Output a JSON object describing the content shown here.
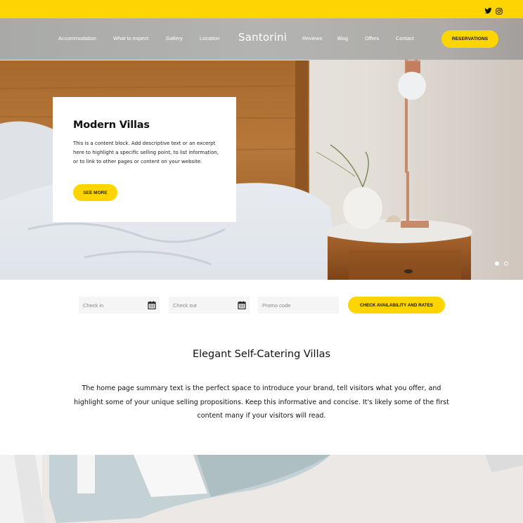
{
  "colors": {
    "accent": "#ffd500",
    "text": "#111111",
    "input_bg": "#f5f5f5"
  },
  "topbar": {
    "social_icons": [
      "twitter-icon",
      "instagram-icon"
    ]
  },
  "header": {
    "brand": "Santorini",
    "nav_left": [
      "Accommodation",
      "What to expect",
      "Gallery",
      "Location"
    ],
    "nav_right": [
      "Reviews",
      "Blog",
      "Offers",
      "Contact"
    ],
    "reservations_label": "RESERVATIONS"
  },
  "hero": {
    "card": {
      "title": "Modern Villas",
      "body": "This is a content block. Add descriptive text or an excerpt here to highlight a specific selling point, to list information, or to link to other pages or content on your website.",
      "button_label": "SEE MORE"
    },
    "slider": {
      "total_slides": 2,
      "active_slide": 1
    }
  },
  "booking": {
    "check_in_placeholder": "Check in",
    "check_out_placeholder": "Check out",
    "promo_placeholder": "Promo code",
    "submit_label": "CHECK AVAILABILITY AND RATES"
  },
  "intro": {
    "title": "Elegant Self-Catering Villas",
    "text": "The home page summary text is the perfect space to introduce your brand, tell visitors what you offer, and highlight some of your unique selling propositions. Keep this informative and concise. It's likely some of the first content many if your visitors will read."
  }
}
